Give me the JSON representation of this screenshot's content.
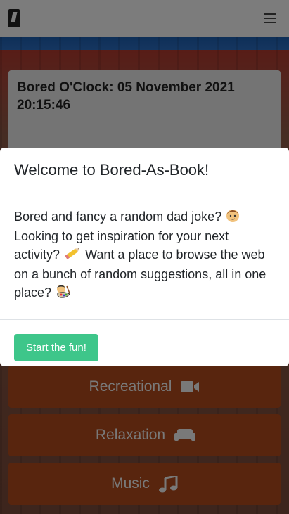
{
  "navbar": {
    "menu_icon": "hamburger-icon",
    "logo_icon": "logo-icon"
  },
  "clock": {
    "label": "Bored O'Clock:",
    "datetime": "05 November 2021 20:15:46"
  },
  "categories": [
    {
      "label": "Recreational",
      "icon": "video-camera-icon"
    },
    {
      "label": "Relaxation",
      "icon": "couch-icon"
    },
    {
      "label": "Music",
      "icon": "music-note-icon"
    }
  ],
  "modal": {
    "title": "Welcome to Bored-As-Book!",
    "body_part1": "Bored and fancy a random dad joke?",
    "body_part2": "Looking to get inspiration for your next activity?",
    "body_part3": "Want a place to browse the web on a bunch of random suggestions, all in one place?",
    "emoji1": "man-face-emoji",
    "emoji2": "pencil-emoji",
    "emoji3": "artist-palette-emoji",
    "start_button": "Start the fun!"
  },
  "colors": {
    "start_button": "#3ec68a",
    "category_button": "#b04a1c",
    "overlay": "rgba(0,0,0,0.5)"
  }
}
